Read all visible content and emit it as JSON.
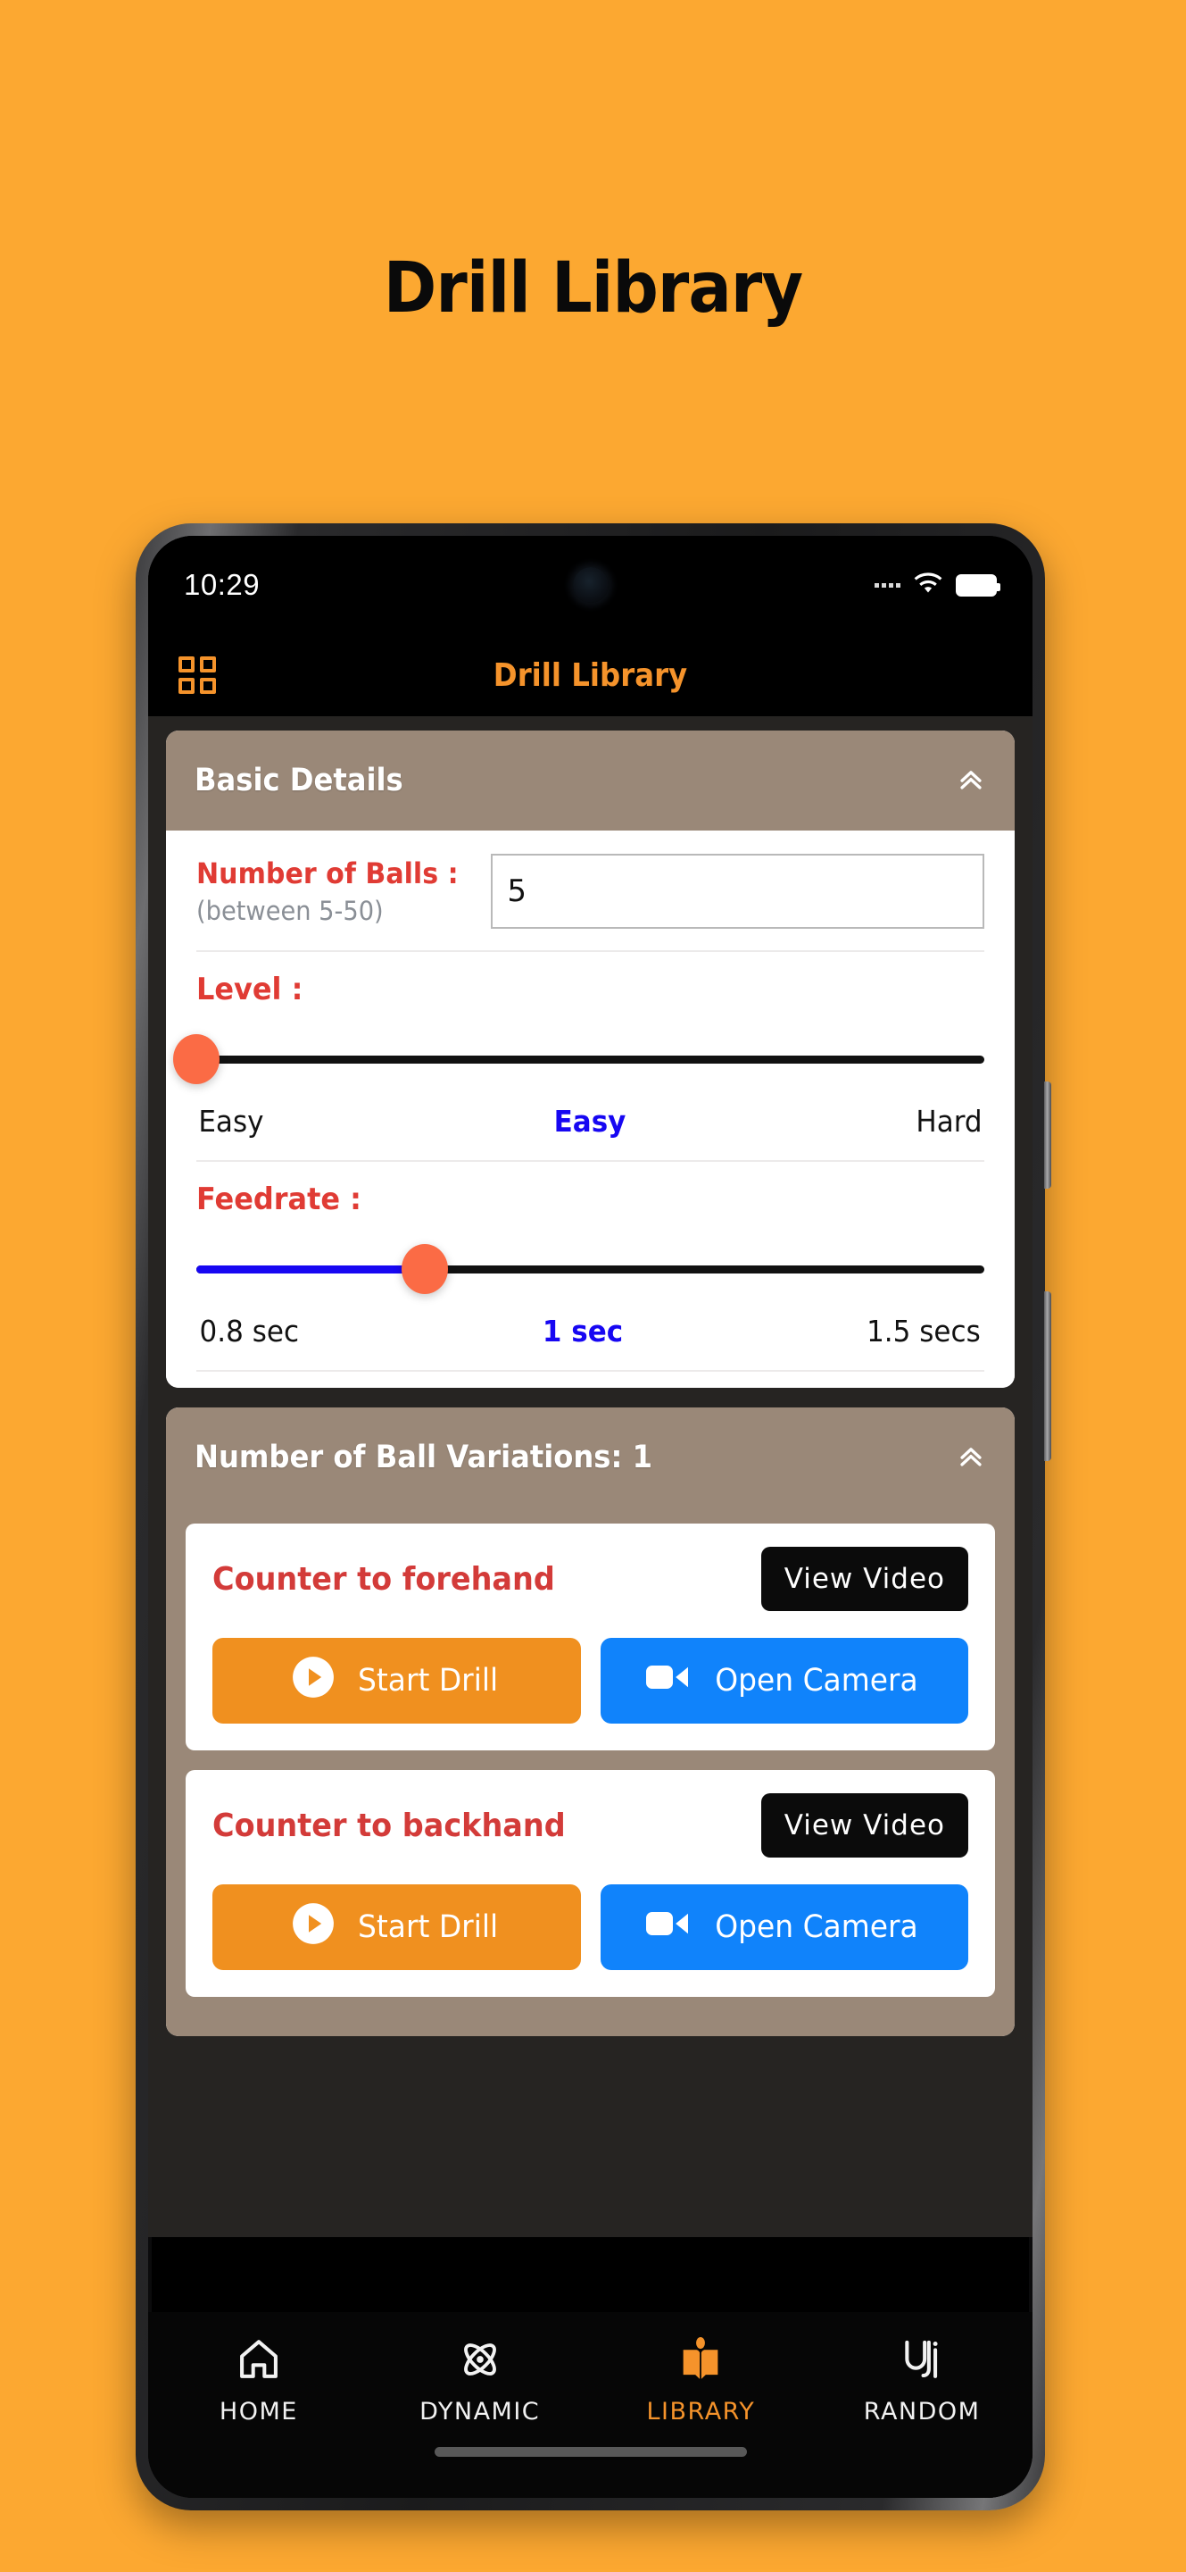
{
  "page": {
    "title": "Drill Library",
    "background_color": "#FCA831"
  },
  "phone": {
    "status_bar": {
      "time": "10:29",
      "icons": [
        "signal-dots-icon",
        "wifi-icon",
        "battery-icon"
      ]
    },
    "app_bar": {
      "menu_icon": "grid-menu-icon",
      "title": "Drill Library",
      "title_color": "#F5932B"
    }
  },
  "basic_details": {
    "header": "Basic Details",
    "collapse_icon": "chevron-up-double-icon",
    "balls": {
      "label": "Number of Balls :",
      "hint": "(between 5-50)",
      "value": "5",
      "placeholder": ""
    },
    "level": {
      "label": "Level :",
      "min_label": "Easy",
      "current_label": "Easy",
      "max_label": "Hard",
      "percent": 0
    },
    "feedrate": {
      "label": "Feedrate :",
      "min_label": "0.8 sec",
      "current_label": "1 sec",
      "max_label": "1.5 secs",
      "percent": 29
    }
  },
  "variations": {
    "header": "Number of Ball Variations: 1",
    "collapse_icon": "chevron-up-double-icon",
    "items": [
      {
        "name": "Counter to forehand",
        "view_video_label": "View  Video",
        "start_label": "Start Drill",
        "camera_label": "Open Camera"
      },
      {
        "name": "Counter to backhand",
        "view_video_label": "View  Video",
        "start_label": "Start Drill",
        "camera_label": "Open Camera"
      }
    ]
  },
  "bottom_nav": {
    "items": [
      {
        "label": "HOME",
        "icon": "home-icon",
        "active": false
      },
      {
        "label": "DYNAMIC",
        "icon": "atom-icon",
        "active": false
      },
      {
        "label": "LIBRARY",
        "icon": "open-book-icon",
        "active": true
      },
      {
        "label": "RANDOM",
        "icon": "shuffle-icon",
        "active": false
      }
    ]
  },
  "colors": {
    "accent_orange": "#F5932B",
    "label_red": "#E03B34",
    "slider_blue": "#1707f2",
    "thumb_orange": "#FB6B45",
    "card_header_taupe": "#9A8878",
    "start_button": "#F0901F",
    "camera_button": "#1083FB"
  }
}
